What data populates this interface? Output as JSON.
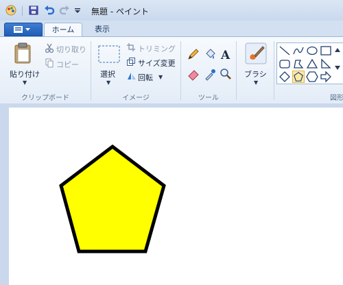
{
  "window": {
    "title": "無題 - ペイント"
  },
  "tabs": {
    "home": "ホーム",
    "view": "表示"
  },
  "clipboard": {
    "paste": "貼り付け",
    "cut": "切り取り",
    "copy": "コピー",
    "group": "クリップボード"
  },
  "image": {
    "select": "選択",
    "crop": "トリミング",
    "resize": "サイズ変更",
    "rotate": "回転",
    "group": "イメージ"
  },
  "tools": {
    "group": "ツール"
  },
  "brushes": {
    "label": "ブラシ"
  },
  "shapes": {
    "group_partial": "図形"
  },
  "colors": {
    "canvas": "#ffffff",
    "pentagon_fill": "#ffff00",
    "pentagon_stroke": "#000000",
    "selected_shape_bg": "#fde9a6"
  },
  "icons": [
    "paint-app-icon",
    "save-icon",
    "undo-icon",
    "redo-icon",
    "customize-dropdown-icon",
    "paint-menu-icon",
    "paste-icon",
    "cut-icon",
    "copy-icon",
    "select-icon",
    "crop-icon",
    "resize-icon",
    "rotate-icon",
    "pencil-icon",
    "fill-icon",
    "text-icon",
    "eraser-icon",
    "color-picker-icon",
    "magnifier-icon",
    "brush-icon"
  ]
}
